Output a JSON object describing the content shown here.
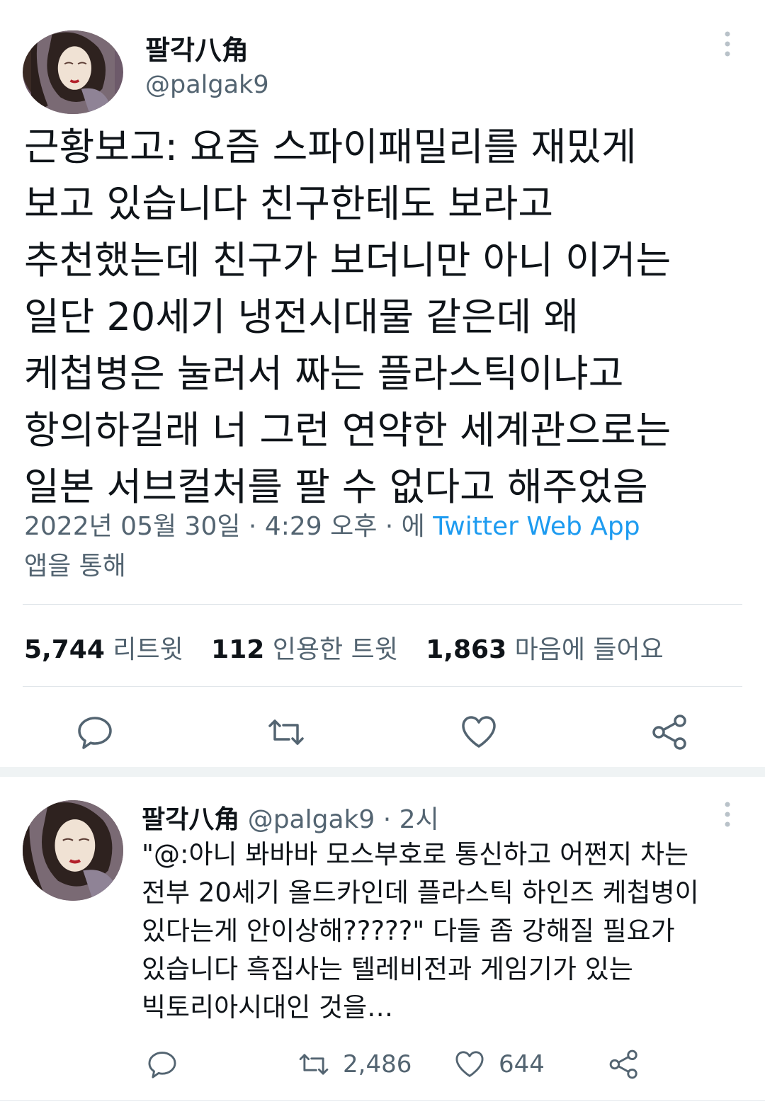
{
  "main_tweet": {
    "display_name": "팔각八角",
    "handle": "@palgak9",
    "text": "근황보고: 요즘 스파이패밀리를 재밌게\n보고 있습니다 친구한테도 보라고\n추천했는데 친구가 보더니만 아니 이거는\n일단 20세기 냉전시대물 같은데 왜\n케첩병은 눌러서 짜는 플라스틱이냐고\n항의하길래 너 그런 연약한 세계관으로는\n일본 서브컬처를 팔 수 없다고 해주었음",
    "timestamp": "2022년 05월 30일 · 4:29 오후 · 에 ",
    "source": "Twitter Web App",
    "source_suffix": "앱을 통해",
    "stats": {
      "retweets_num": "5,744",
      "retweets_label": "리트윗",
      "quotes_num": "112",
      "quotes_label": "인용한 트윗",
      "likes_num": "1,863",
      "likes_label": "마음에 들어요"
    },
    "actions": [
      "reply",
      "retweet",
      "like",
      "share"
    ]
  },
  "reply_tweet": {
    "display_name": "팔각八角",
    "handle_time": "@palgak9 · 2시",
    "text": "\"@:아니 봐바바 모스부호로 통신하고 어쩐지 차는\n전부 20세기 올드카인데 플라스틱 하인즈 케첩병이\n있다는게 안이상해?????\" 다들 좀 강해질 필요가\n있습니다 흑집사는 텔레비전과 게임기가 있는\n빅토리아시대인 것을…",
    "retweet_count": "2,486",
    "like_count": "644"
  },
  "colors": {
    "text": "#0f1419",
    "secondary": "#536471",
    "link": "#1d9bf0",
    "divider": "#e1e6ea"
  }
}
